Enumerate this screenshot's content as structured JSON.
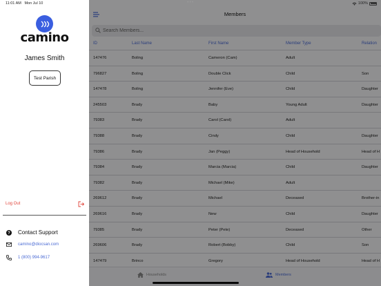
{
  "status_bar": {
    "time": "11:01 AM",
    "date": "Mon Jul 10",
    "battery": "100%"
  },
  "sidebar": {
    "logo_text": "camino",
    "user_name": "James Smith",
    "parish_button": "Test Parish",
    "logout_label": "Log Out",
    "support_title": "Contact Support",
    "support_email": "camino@diocsan.com",
    "support_phone": "1 (800) 994-9617"
  },
  "main": {
    "title": "Members",
    "search_placeholder": "Search Members...",
    "columns": [
      "ID",
      "Last Name",
      "First Name",
      "Member Type",
      "Relation"
    ],
    "rows": [
      [
        "147476",
        "Boling",
        "Cameron (Cam)",
        "Adult",
        ""
      ],
      [
        "796827",
        "Boling",
        "Double Click",
        "Child",
        "Son"
      ],
      [
        "147478",
        "Boling",
        "Jennifer (Eve)",
        "Child",
        "Daughter"
      ],
      [
        "245503",
        "Brady",
        "Baby",
        "Young Adult",
        "Daughter"
      ],
      [
        "79383",
        "Brady",
        "Carol (Carol)",
        "Adult",
        ""
      ],
      [
        "79388",
        "Brady",
        "Cindy",
        "Child",
        "Daughter"
      ],
      [
        "79386",
        "Brady",
        "Jan (Peggy)",
        "Head of Household",
        "Head of H"
      ],
      [
        "79384",
        "Brady",
        "Marcia (Marcia)",
        "Child",
        "Daughter"
      ],
      [
        "79382",
        "Brady",
        "Michael (Mike)",
        "Adult",
        ""
      ],
      [
        "269612",
        "Brady",
        "Michael",
        "Deceased",
        "Brother-in"
      ],
      [
        "269616",
        "Brady",
        "New",
        "Child",
        "Daughter"
      ],
      [
        "79385",
        "Brady",
        "Peter (Pete)",
        "Deceased",
        "Other"
      ],
      [
        "269606",
        "Brady",
        "Robert (Bobby)",
        "Child",
        "Son"
      ],
      [
        "147479",
        "Brinco",
        "Gregory",
        "Head of Household",
        "Head of H"
      ]
    ],
    "tabs": {
      "households": "Households",
      "members": "Members"
    }
  },
  "colors": {
    "accent": "#4a6ad4",
    "logout": "#e0443a",
    "logo_blue": "#3a5ee0"
  }
}
